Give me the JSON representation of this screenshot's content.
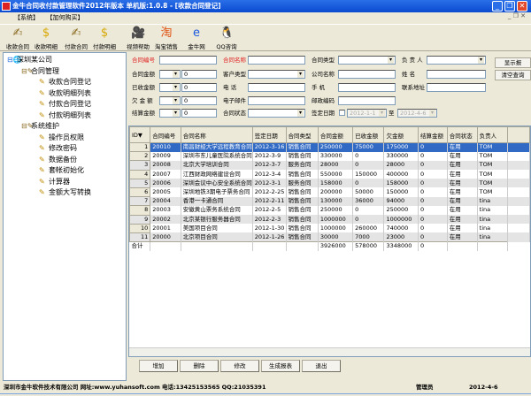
{
  "window": {
    "title": "金牛合同收付款管理软件2012年版本 单机版:1.0.8 - [收款合同登记]",
    "controls": [
      "_",
      "❐",
      "✕"
    ]
  },
  "menu": [
    "【系统】",
    "【加何购买】"
  ],
  "toolbar": [
    {
      "label": "收款合同",
      "icon": "contract-pen-icon",
      "glyph": "✍"
    },
    {
      "label": "收款明细",
      "icon": "dollar-ledger-icon",
      "glyph": "$"
    },
    {
      "label": "付款合同",
      "icon": "contract-pen-icon",
      "glyph": "✍"
    },
    {
      "label": "付款明细",
      "icon": "dollar-ledger-icon",
      "glyph": "$"
    },
    {
      "label": "视频帮助",
      "icon": "video-camera-icon",
      "glyph": "🎥"
    },
    {
      "label": "淘宝销售",
      "icon": "taobao-icon",
      "glyph": "淘"
    },
    {
      "label": "金牛网",
      "icon": "ie-browser-icon",
      "glyph": "e"
    },
    {
      "label": "QQ咨询",
      "icon": "qq-penguin-icon",
      "glyph": "🐧"
    }
  ],
  "tree": {
    "root": "深圳某公司",
    "groups": [
      {
        "label": "合同管理",
        "items": [
          "收款合同登记",
          "收款明细列表",
          "付款合同登记",
          "付款明细列表"
        ]
      },
      {
        "label": "系统维护",
        "items": [
          "操作员权限",
          "修改密码",
          "数据备份",
          "套帐初始化",
          "计算器",
          "金额大写转换"
        ]
      }
    ]
  },
  "form": {
    "contract_no": "合同编号",
    "contract_name": "合同名称",
    "contract_type": "合同类型",
    "owner": "负 责 人",
    "amount": "合同金额",
    "amount_value": "0",
    "customer_type": "客户类型",
    "company": "公司名称",
    "name": "姓  名",
    "received": "已收金额",
    "received_value": "0",
    "phone": "电  话",
    "mobile": "手  机",
    "address": "联系地址",
    "owed": "欠 金 额",
    "owed_value": "0",
    "email": "电子邮件",
    "postcode": "邮政编码",
    "settled": "结算金额",
    "settled_value": "0",
    "status": "合同状态",
    "sign_date": "签定日期",
    "date_from": "2012-1-1",
    "to": "至",
    "date_to": "2012-4-6",
    "show_button": "显示报",
    "clear_button": "清空查询"
  },
  "grid": {
    "columns": [
      "ID▼",
      "合同编号",
      "合同名称",
      "签定日期",
      "合同类型",
      "合同金额",
      "已收金额",
      "欠金额",
      "结算金额",
      "合同状态",
      "负责人"
    ],
    "rows": [
      [
        "1",
        "20010",
        "南昌财经大学远程教育合同",
        "2012-3-16",
        "销售合同",
        "250000",
        "75000",
        "175000",
        "0",
        "在用",
        "TOM"
      ],
      [
        "2",
        "20009",
        "深圳市东儿童医院系统合同",
        "2012-3-9",
        "销售合同",
        "330000",
        "0",
        "330000",
        "0",
        "在用",
        "TOM"
      ],
      [
        "3",
        "20008",
        "北京大学培训合同",
        "2012-3-7",
        "服务合同",
        "28000",
        "0",
        "28000",
        "0",
        "在用",
        "TOM"
      ],
      [
        "4",
        "20007",
        "江西财政网络建设合同",
        "2012-3-4",
        "销售合同",
        "550000",
        "150000",
        "400000",
        "0",
        "在用",
        "TOM"
      ],
      [
        "5",
        "20006",
        "深圳会议中心安全系统合同",
        "2012-3-1",
        "服务合同",
        "158000",
        "0",
        "158000",
        "0",
        "在用",
        "TOM"
      ],
      [
        "6",
        "20005",
        "深圳地铁3期电子票务合同",
        "2012-2-25",
        "销售合同",
        "200000",
        "50000",
        "150000",
        "0",
        "在用",
        "TOM"
      ],
      [
        "7",
        "20004",
        "香港一卡通合同",
        "2012-2-11",
        "销售合同",
        "130000",
        "36000",
        "94000",
        "0",
        "在用",
        "tina"
      ],
      [
        "8",
        "20003",
        "安徽黄山票务系统合同",
        "2012-2-5",
        "销售合同",
        "250000",
        "0",
        "250000",
        "0",
        "在用",
        "tina"
      ],
      [
        "9",
        "20002",
        "北京某银行服务器合同",
        "2012-2-3",
        "销售合同",
        "1000000",
        "0",
        "1000000",
        "0",
        "在用",
        "tina"
      ],
      [
        "10",
        "20001",
        "美国项目合同",
        "2012-1-30",
        "销售合同",
        "1000000",
        "260000",
        "740000",
        "0",
        "在用",
        "tina"
      ],
      [
        "11",
        "20000",
        "北京项目合同",
        "2012-1-26",
        "销售合同",
        "30000",
        "7000",
        "23000",
        "0",
        "在用",
        "tina"
      ]
    ],
    "total": [
      "合计",
      "",
      "",
      "",
      "",
      "3926000",
      "578000",
      "3348000",
      "0",
      "",
      ""
    ]
  },
  "buttons": {
    "add": "增加",
    "delete": "删除",
    "edit": "修改",
    "report": "生成报表",
    "exit": "退出"
  },
  "status": {
    "company": "深圳市金牛软件技术有限公司 网址:www.yuhansoft.com 电话:13425153565 QQ:21035391",
    "user": "管理员",
    "date": "2012-4-6"
  }
}
